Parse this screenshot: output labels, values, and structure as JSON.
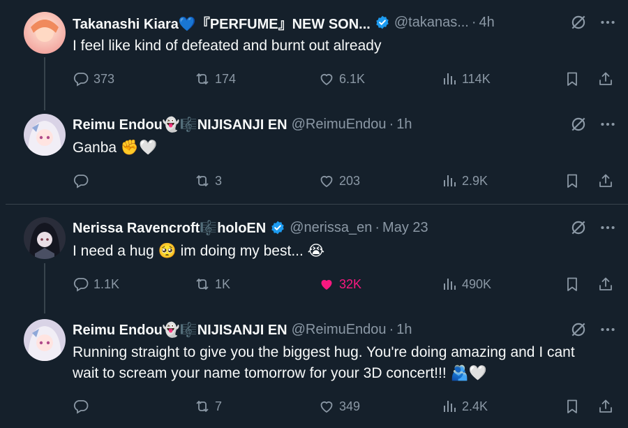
{
  "colors": {
    "background": "#15202b",
    "muted": "#8b98a5",
    "like_active": "#f91880",
    "verified": "#1d9bf0"
  },
  "tweets": [
    {
      "name": "Takanashi Kiara💙『PERFUME』NEW SON...",
      "handle": "@takanas...",
      "separator": "·",
      "time": "4h",
      "verified": true,
      "text": "I feel like kind of defeated and burnt out already",
      "replies": "373",
      "retweets": "174",
      "likes": "6.1K",
      "views": "114K",
      "liked": false
    },
    {
      "name": "Reimu Endou👻🎼NIJISANJI EN",
      "handle": "@ReimuEndou",
      "separator": "·",
      "time": "1h",
      "verified": false,
      "text": "Ganba ✊🤍",
      "replies": "",
      "retweets": "3",
      "likes": "203",
      "views": "2.9K",
      "liked": false
    },
    {
      "name": "Nerissa Ravencroft🎼holoEN",
      "handle": "@nerissa_en",
      "separator": "·",
      "time": "May 23",
      "verified": true,
      "text": "I need a hug 🥺 im doing my best... 😭",
      "replies": "1.1K",
      "retweets": "1K",
      "likes": "32K",
      "views": "490K",
      "liked": true
    },
    {
      "name": "Reimu Endou👻🎼NIJISANJI EN",
      "handle": "@ReimuEndou",
      "separator": "·",
      "time": "1h",
      "verified": false,
      "text": "Running straight to give you the biggest hug. You're doing amazing and I cant wait to scream your name tomorrow for your 3D concert!!! 🫂🤍",
      "replies": "",
      "retweets": "7",
      "likes": "349",
      "views": "2.4K",
      "liked": false
    }
  ]
}
